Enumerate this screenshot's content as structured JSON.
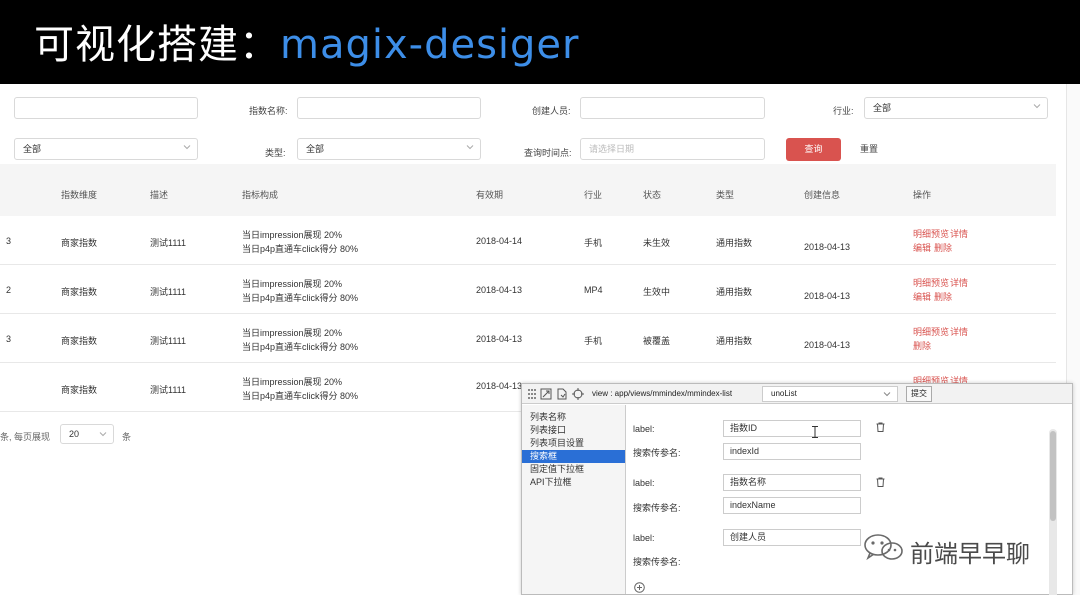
{
  "banner": {
    "title_cn": "可视化搭建：",
    "title_en": "magix-desiger"
  },
  "filters": {
    "row1": {
      "field1_value": "",
      "index_name_label": "指数名称:",
      "index_name_value": "",
      "creator_label": "创建人员:",
      "creator_value": "",
      "industry_label": "行业:",
      "industry_value": "全部"
    },
    "row2": {
      "field1_value": "全部",
      "type_label": "类型:",
      "type_value": "全部",
      "query_time_label": "查询时间点:",
      "query_time_placeholder": "请选择日期",
      "search_button": "查询",
      "reset_button": "重置"
    }
  },
  "table": {
    "headers": [
      "指数维度",
      "描述",
      "指标构成",
      "有效期",
      "行业",
      "状态",
      "类型",
      "创建信息",
      "操作"
    ],
    "rows": [
      {
        "id_fragment": "3",
        "dimension": "商家指数",
        "description": "测试1111",
        "composition_1": "当日impression展现 20%",
        "composition_2": "当日p4p直通车click得分 80%",
        "valid_date": "2018-04-14",
        "industry": "手机",
        "status": "未生效",
        "type": "通用指数",
        "created": "2018-04-13",
        "op_preview": "明细预览",
        "op_detail": "详情",
        "op_edit": "编辑",
        "op_delete": "删除"
      },
      {
        "id_fragment": "2",
        "dimension": "商家指数",
        "description": "测试1111",
        "composition_1": "当日impression展现 20%",
        "composition_2": "当日p4p直通车click得分 80%",
        "valid_date": "2018-04-13",
        "industry": "MP4",
        "status": "生效中",
        "type": "通用指数",
        "created": "2018-04-13",
        "op_preview": "明细预览",
        "op_detail": "详情",
        "op_edit": "编辑",
        "op_delete": "删除"
      },
      {
        "id_fragment": "3",
        "dimension": "商家指数",
        "description": "测试1111",
        "composition_1": "当日impression展现 20%",
        "composition_2": "当日p4p直通车click得分 80%",
        "valid_date": "2018-04-13",
        "industry": "手机",
        "status": "被覆盖",
        "type": "通用指数",
        "created": "2018-04-13",
        "op_preview": "明细预览",
        "op_detail": "详情",
        "op_delete": "删除"
      },
      {
        "id_fragment": "",
        "dimension": "商家指数",
        "description": "测试1111",
        "composition_1": "当日impression展现 20%",
        "composition_2": "当日p4p直通车click得分 80%",
        "valid_date": "2018-04-13",
        "op_preview": "明细预览",
        "op_detail": "详情"
      }
    ]
  },
  "pagination": {
    "prefix": "条, 每页展现",
    "page_size": "20",
    "suffix": "条"
  },
  "dev_panel": {
    "path": "view : app/views/mmindex/mmindex-list",
    "view_select": "unoList",
    "submit": "提交",
    "nav": [
      "列表名称",
      "列表接口",
      "列表项目设置",
      "搜索框",
      "固定值下拉框",
      "API下拉框"
    ],
    "active_nav": "搜索框",
    "fields": [
      {
        "label_key": "label:",
        "label_value": "指数ID",
        "param_key": "搜索传参名:",
        "param_value": "indexId"
      },
      {
        "label_key": "label:",
        "label_value": "指数名称",
        "param_key": "搜索传参名:",
        "param_value": "indexName"
      },
      {
        "label_key": "label:",
        "label_value": "创建人员",
        "param_key": "搜索传参名:",
        "param_value": ""
      }
    ]
  },
  "watermark": {
    "text": "前端早早聊"
  }
}
